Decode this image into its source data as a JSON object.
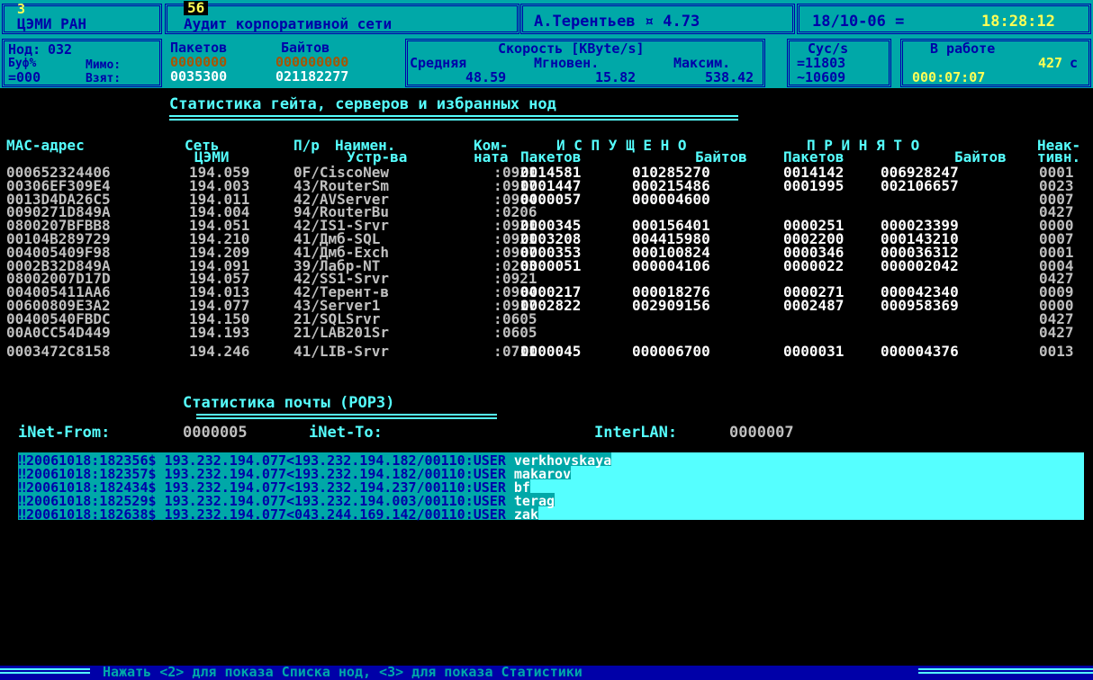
{
  "header": {
    "org_num": "3",
    "org": "ЦЭМИ РАН",
    "audit_num": "56",
    "audit_title": "Аудит корпоративной сети",
    "user": "А.Терентьев ¤ 4.73",
    "date": "18/10-06 =",
    "time": "18:28:12"
  },
  "stats": {
    "nod_label": "Нод:",
    "nod_value": "032",
    "buf_label": "Буф%",
    "buf_value": "=000",
    "mimo_label": "Мимо:",
    "vzyat_label": "Взят:",
    "packets_label": "Пакетов",
    "bytes_label": "Байтов",
    "mimo_packets": "0000000",
    "mimo_bytes": "000000000",
    "vzyat_packets": "0035300",
    "vzyat_bytes": "021182277",
    "speed_label": "Скорость [KByte/s]",
    "avg_label": "Средняя",
    "inst_label": "Мгновен.",
    "max_label": "Максим.",
    "avg_value": "48.59",
    "inst_value": "15.82",
    "max_value": "538.42",
    "sys_label": "Сус/s",
    "sys_value1": "=11803",
    "sys_value2": "~10609",
    "work_label": "В работе",
    "work_days": "427",
    "work_c": "с",
    "work_time": "000:07:07"
  },
  "gate": {
    "title": "Статистика гейта, серверов и избранных нод",
    "columns": {
      "mac": "MAC-адрес",
      "net1": "Сеть",
      "net2": "ЦЭМИ",
      "pr": "П/р",
      "name1": "Наимен.",
      "name2": "Устр-ва",
      "room1": "Ком-",
      "room2": "ната",
      "sent": "И С П У Щ Е Н О",
      "recv": "П Р И Н Я Т О",
      "packets": "Пакетов",
      "bytes": "Байтов",
      "inact1": "Неак-",
      "inact2": "тивн."
    },
    "rows": [
      {
        "mac": "000652324406",
        "net": "194.059",
        "name": "0F/CiscoNew",
        "room": "0921",
        "sp": "0014581",
        "sb": "010285270",
        "rp": "0014142",
        "rb": "006928247",
        "ina": "0001"
      },
      {
        "mac": "00306EF309E4",
        "net": "194.003",
        "name": "43/RouterSm",
        "room": "0917",
        "sp": "0001447",
        "sb": "000215486",
        "rp": "0001995",
        "rb": "002106657",
        "ina": "0023"
      },
      {
        "mac": "0013D4DA26C5",
        "net": "194.011",
        "name": "42/AVServer",
        "room": "0904",
        "sp": "0000057",
        "sb": "000004600",
        "rp": "",
        "rb": "",
        "ina": "0007"
      },
      {
        "mac": "0090271D849A",
        "net": "194.004",
        "name": "94/RouterBu",
        "room": "0206",
        "sp": "",
        "sb": "",
        "rp": "",
        "rb": "",
        "ina": "0427"
      },
      {
        "mac": "0800207BFBB8",
        "net": "194.051",
        "name": "42/IS1-Srvr",
        "room": "0921",
        "sp": "0000345",
        "sb": "000156401",
        "rp": "0000251",
        "rb": "000023399",
        "ina": "0000"
      },
      {
        "mac": "00104B289729",
        "net": "194.210",
        "name": "41/Дмб-SQL",
        "room": "0921",
        "sp": "0003208",
        "sb": "004415980",
        "rp": "0002200",
        "rb": "000143210",
        "ina": "0007"
      },
      {
        "mac": "004005409F98",
        "net": "194.209",
        "name": "41/Дмб-Exch",
        "room": "0907",
        "sp": "0000353",
        "sb": "000100824",
        "rp": "0000346",
        "rb": "000036312",
        "ina": "0001"
      },
      {
        "mac": "0002B32D849A",
        "net": "194.091",
        "name": "39/Лабр-NT",
        "room": "0203",
        "sp": "0000051",
        "sb": "000004106",
        "rp": "0000022",
        "rb": "000002042",
        "ina": "0004"
      },
      {
        "mac": "08002007D17D",
        "net": "194.057",
        "name": "42/SS1-Srvr",
        "room": "0921",
        "sp": "",
        "sb": "",
        "rp": "",
        "rb": "",
        "ina": "0427"
      },
      {
        "mac": "004005411AA6",
        "net": "194.013",
        "name": "42/Терент-в",
        "room": "0904",
        "sp": "0000217",
        "sb": "000018276",
        "rp": "0000271",
        "rb": "000042340",
        "ina": "0009"
      },
      {
        "mac": "00600809E3A2",
        "net": "194.077",
        "name": "43/Server1",
        "room": "0917",
        "sp": "0002822",
        "sb": "002909156",
        "rp": "0002487",
        "rb": "000958369",
        "ina": "0000"
      },
      {
        "mac": "00400540FBDC",
        "net": "194.150",
        "name": "21/SQLSrvr",
        "room": "0605",
        "sp": "",
        "sb": "",
        "rp": "",
        "rb": "",
        "ina": "0427"
      },
      {
        "mac": "00A0CC54D449",
        "net": "194.193",
        "name": "21/LAB201Sr",
        "room": "0605",
        "sp": "",
        "sb": "",
        "rp": "",
        "rb": "",
        "ina": "0427"
      },
      {
        "mac": "0003472C8158",
        "net": "194.246",
        "name": "41/LIB-Srvr",
        "room": "0711",
        "sp": "0000045",
        "sb": "000006700",
        "rp": "0000031",
        "rb": "000004376",
        "ina": "0013"
      }
    ]
  },
  "mail": {
    "title": "Статистика почты (POP3)",
    "inet_from_label": "iNet-From:",
    "inet_from_value": "0000005",
    "inet_to_label": "iNet-To:",
    "interlan_label": "InterLAN:",
    "interlan_value": "0000007",
    "log": [
      {
        "text": "‼20061018:182356$ 193.232.194.077<193.232.194.182/00110:USER ",
        "user": "verkhovskaya"
      },
      {
        "text": "‼20061018:182357$ 193.232.194.077<193.232.194.182/00110:USER ",
        "user": "makarov"
      },
      {
        "text": "‼20061018:182434$ 193.232.194.077<193.232.194.237/00110:USER ",
        "user": "bf"
      },
      {
        "text": "‼20061018:182529$ 193.232.194.077<193.232.194.003/00110:USER ",
        "user": "terag"
      },
      {
        "text": "‼20061018:182638$ 193.232.194.077<043.244.169.142/00110:USER ",
        "user": "zak"
      }
    ]
  },
  "footer": {
    "hint": "Нажать <2> для показа Списка нод, <3> для показа Статистики"
  }
}
